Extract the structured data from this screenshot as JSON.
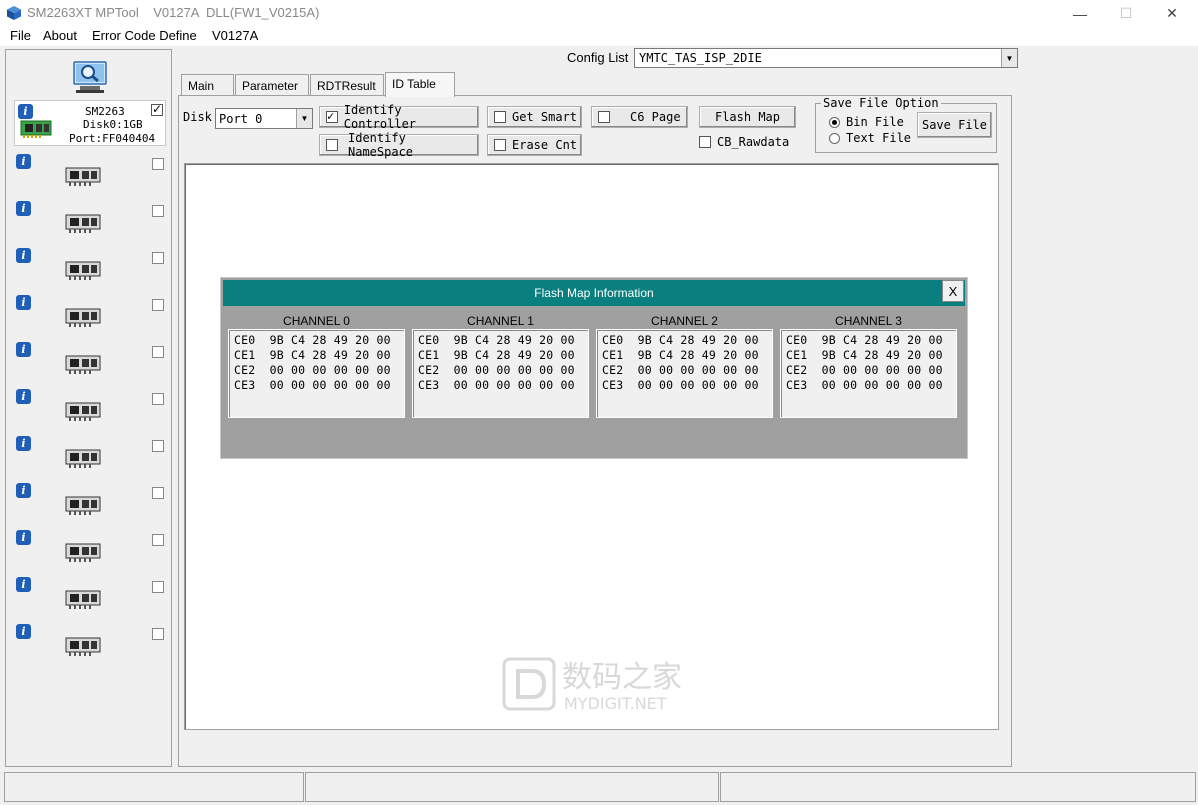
{
  "window": {
    "title": "SM2263XT MPTool    V0127A  DLL(FW1_V0215A)",
    "minimize": "—",
    "maximize": "☐",
    "close": "✕"
  },
  "menu": [
    "File",
    "About",
    "Error Code Define",
    "V0127A"
  ],
  "devices": {
    "port0": {
      "line1": "SM2263",
      "line2": "Disk0:1GB",
      "line3": "Port:FF040404",
      "checked": true
    },
    "empty_slot_count": 11
  },
  "config": {
    "label": "Config List",
    "value": "YMTC_TAS_ISP_2DIE"
  },
  "tabs": [
    "Main",
    "Parameter",
    "RDTResult",
    "ID Table"
  ],
  "active_tab": "ID Table",
  "controls": {
    "disk_label": "Disk",
    "disk_value": "Port 0",
    "identify_controller": "Identify Controller",
    "identify_namespace": "Identify NameSpace",
    "get_smart": "Get Smart",
    "erase_cnt": "Erase Cnt",
    "c6_page": "C6 Page",
    "flash_map": "Flash Map",
    "cb_rawdata": "CB_Rawdata",
    "save_option_title": "Save File Option",
    "bin_file": "Bin File",
    "text_file": "Text File",
    "save_file": "Save File"
  },
  "flash_map": {
    "title": "Flash Map Information",
    "close": "X",
    "channels": [
      {
        "name": "CHANNEL 0",
        "lines": [
          "CE0  9B C4 28 49 20 00",
          "CE1  9B C4 28 49 20 00",
          "CE2  00 00 00 00 00 00",
          "CE3  00 00 00 00 00 00"
        ]
      },
      {
        "name": "CHANNEL 1",
        "lines": [
          "CE0  9B C4 28 49 20 00",
          "CE1  9B C4 28 49 20 00",
          "CE2  00 00 00 00 00 00",
          "CE3  00 00 00 00 00 00"
        ]
      },
      {
        "name": "CHANNEL 2",
        "lines": [
          "CE0  9B C4 28 49 20 00",
          "CE1  9B C4 28 49 20 00",
          "CE2  00 00 00 00 00 00",
          "CE3  00 00 00 00 00 00"
        ]
      },
      {
        "name": "CHANNEL 3",
        "lines": [
          "CE0  9B C4 28 49 20 00",
          "CE1  9B C4 28 49 20 00",
          "CE2  00 00 00 00 00 00",
          "CE3  00 00 00 00 00 00"
        ]
      }
    ]
  },
  "watermark": {
    "cn": "数码之家",
    "en": "MYDIGIT.NET"
  }
}
